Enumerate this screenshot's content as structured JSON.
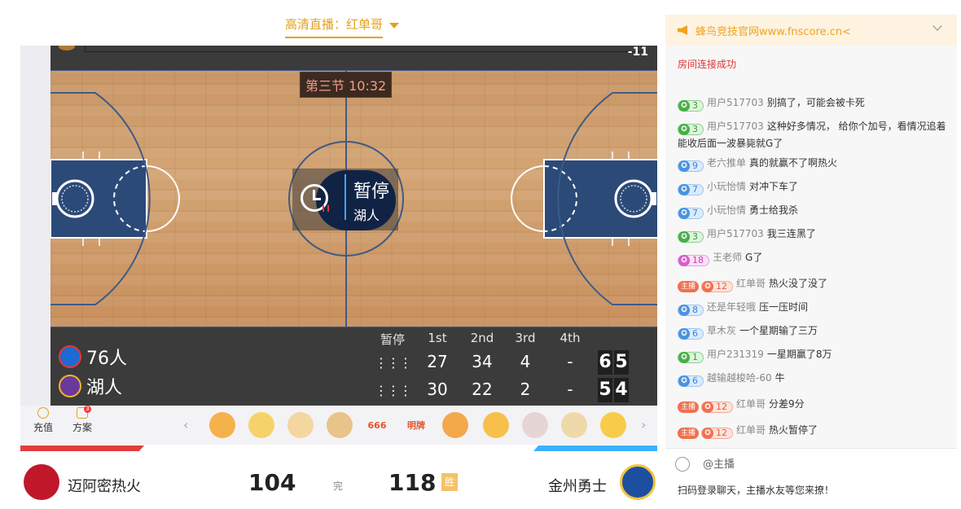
{
  "live": {
    "tab_label": "高清直播：红单哥"
  },
  "player": {
    "score_diff": "-11",
    "quarter_time": "第三节 10:32",
    "pause_title": "暂停",
    "pause_team": "湖人"
  },
  "scoreboard": {
    "headers": [
      "暂停",
      "1st",
      "2nd",
      "3rd",
      "4th"
    ],
    "rows": [
      {
        "team": "76人",
        "pause": "⋮⋮⋮",
        "q1": "27",
        "q2": "34",
        "q3": "4",
        "q4": "-",
        "total_d1": "6",
        "total_d2": "5"
      },
      {
        "team": "湖人",
        "pause": "⋮⋮⋮",
        "q1": "30",
        "q2": "22",
        "q3": "2",
        "q4": "-",
        "total_d1": "5",
        "total_d2": "4"
      }
    ]
  },
  "giftbar": {
    "recharge": "充值",
    "plan": "方案",
    "plan_badge": "3",
    "gifts": [
      "honey-jar-icon",
      "like-icon",
      "receive-icon",
      "cow-icon",
      "666",
      "明牌",
      "gourd-icon",
      "shield-icon",
      "girl-icon",
      "sword-icon",
      "crown-icon"
    ],
    "gift_666": "666",
    "gift_mingpai": "明牌"
  },
  "match": {
    "home_team": "迈阿密热火",
    "home_score": "104",
    "status": "完",
    "away_score": "118",
    "win_tag": "胜",
    "away_team": "金州勇士"
  },
  "chat": {
    "header": "蜂鸟竞技官网www.fnscore.cn<",
    "system": "房间连接成功",
    "messages": [
      {
        "level": "3",
        "color": "green",
        "host": false,
        "user": "用户517703",
        "text": "别搞了，可能会被卡死"
      },
      {
        "level": "3",
        "color": "green",
        "host": false,
        "user": "用户517703",
        "text": "这种好多情况， 给你个加号，看情况追着能收后面一波暴毙就G了"
      },
      {
        "level": "9",
        "color": "blue",
        "host": false,
        "user": "老六推单",
        "text": "真的就赢不了啊热火"
      },
      {
        "level": "7",
        "color": "blue",
        "host": false,
        "user": "小玩怡情",
        "text": "对冲下车了"
      },
      {
        "level": "7",
        "color": "blue",
        "host": false,
        "user": "小玩怡情",
        "text": "勇士给我杀"
      },
      {
        "level": "3",
        "color": "green",
        "host": false,
        "user": "用户517703",
        "text": "我三连黑了"
      },
      {
        "level": "18",
        "color": "pink",
        "host": false,
        "user": "王老师",
        "text": "G了"
      },
      {
        "level": "12",
        "color": "orange",
        "host": true,
        "user": "红单哥",
        "text": "热火没了没了"
      },
      {
        "level": "8",
        "color": "blue",
        "host": false,
        "user": "还是年轻哦",
        "text": "压一压时间"
      },
      {
        "level": "6",
        "color": "blue",
        "host": false,
        "user": "草木灰",
        "text": "一个星期输了三万"
      },
      {
        "level": "1",
        "color": "green",
        "host": false,
        "user": "用户231319",
        "text": "一星期赢了8万"
      },
      {
        "level": "6",
        "color": "blue",
        "host": false,
        "user": "越输越梭哈-60",
        "text": "牛"
      },
      {
        "level": "12",
        "color": "orange",
        "host": true,
        "user": "红单哥",
        "text": "分差9分"
      },
      {
        "level": "12",
        "color": "orange",
        "host": true,
        "user": "红单哥",
        "text": "热火暂停了"
      }
    ],
    "host_tag": "主播",
    "at_host": "@主播",
    "login_hint": "扫码登录聊天，主播水友等您来撩！"
  },
  "colors": {
    "accent": "#e4a21a",
    "heat_red": "#e43d3d",
    "warriors_blue": "#3ab2ff",
    "court_blue": "#2c4a78"
  }
}
